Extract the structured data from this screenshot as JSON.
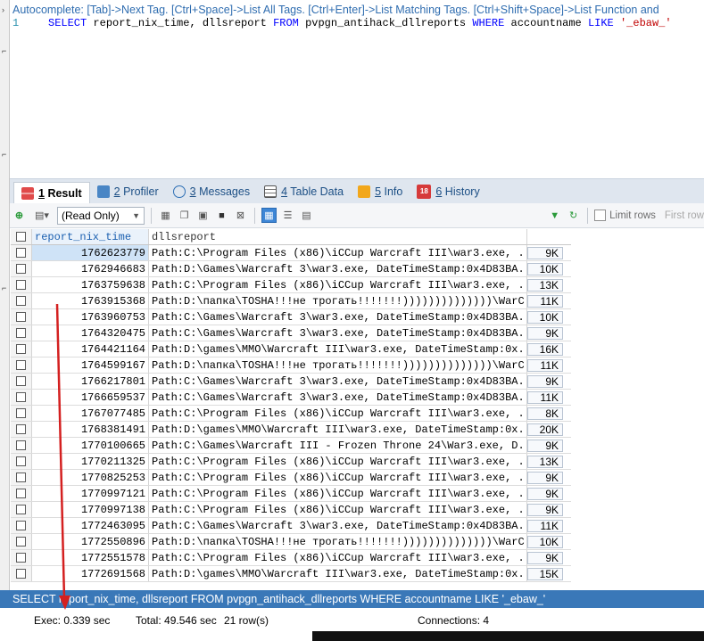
{
  "editor": {
    "autocomplete_hint": "Autocomplete: [Tab]->Next Tag. [Ctrl+Space]->List All Tags. [Ctrl+Enter]->List Matching Tags. [Ctrl+Shift+Space]->List Function and ",
    "line_number": "1",
    "sql": {
      "select": "SELECT",
      "cols": "report_nix_time, dllsreport",
      "from": "FROM",
      "table": "pvpgn_antihack_dllreports",
      "where": "WHERE",
      "col": "accountname",
      "like": "LIKE",
      "value": "'_ebaw_'"
    }
  },
  "tabs": [
    {
      "num": "1",
      "label": "Result",
      "icon": "result-grid-icon"
    },
    {
      "num": "2",
      "label": "Profiler",
      "icon": "profiler-icon"
    },
    {
      "num": "3",
      "label": "Messages",
      "icon": "info-circle-icon"
    },
    {
      "num": "4",
      "label": "Table Data",
      "icon": "table-icon"
    },
    {
      "num": "5",
      "label": "Info",
      "icon": "info-icon"
    },
    {
      "num": "6",
      "label": "History",
      "icon": "calendar-icon",
      "badge": "18"
    }
  ],
  "toolbar": {
    "mode_select": "(Read Only)",
    "limit_rows_label": "Limit rows",
    "first_row_label": "First row"
  },
  "grid": {
    "columns": [
      "report_nix_time",
      "dllsreport"
    ],
    "rows": [
      {
        "time": "1762623779",
        "dll": "Path:C:\\Program Files (x86)\\iCCup Warcraft III\\war3.exe, ...",
        "size": "9K"
      },
      {
        "time": "1762946683",
        "dll": "Path:D:\\Games\\Warcraft 3\\war3.exe, DateTimeStamp:0x4D83BA...",
        "size": "10K"
      },
      {
        "time": "1763759638",
        "dll": "Path:C:\\Program Files (x86)\\iCCup Warcraft III\\war3.exe, ...",
        "size": "13K"
      },
      {
        "time": "1763915368",
        "dll": "Path:D:\\папка\\TOSHA!!!не трогать!!!!!!!))))))))))))))\\WarC...",
        "size": "11K"
      },
      {
        "time": "1763960753",
        "dll": "Path:C:\\Games\\Warcraft 3\\war3.exe, DateTimeStamp:0x4D83BA...",
        "size": "10K"
      },
      {
        "time": "1764320475",
        "dll": "Path:C:\\Games\\Warcraft 3\\war3.exe, DateTimeStamp:0x4D83BA...",
        "size": "9K"
      },
      {
        "time": "1764421164",
        "dll": "Path:D:\\games\\MMO\\Warcraft III\\war3.exe, DateTimeStamp:0x...",
        "size": "16K"
      },
      {
        "time": "1764599167",
        "dll": "Path:D:\\папка\\TOSHA!!!не трогать!!!!!!!))))))))))))))\\WarC...",
        "size": "11K"
      },
      {
        "time": "1766217801",
        "dll": "Path:C:\\Games\\Warcraft 3\\war3.exe, DateTimeStamp:0x4D83BA...",
        "size": "9K"
      },
      {
        "time": "1766659537",
        "dll": "Path:C:\\Games\\Warcraft 3\\war3.exe, DateTimeStamp:0x4D83BA...",
        "size": "11K"
      },
      {
        "time": "1767077485",
        "dll": "Path:C:\\Program Files (x86)\\iCCup Warcraft III\\war3.exe, ...",
        "size": "8K"
      },
      {
        "time": "1768381491",
        "dll": "Path:D:\\games\\MMO\\Warcraft III\\war3.exe, DateTimeStamp:0x...",
        "size": "20K"
      },
      {
        "time": "1770100665",
        "dll": "Path:C:\\Games\\Warcraft III - Frozen Throne 24\\War3.exe, D...",
        "size": "9K"
      },
      {
        "time": "1770211325",
        "dll": "Path:C:\\Program Files (x86)\\iCCup Warcraft III\\war3.exe, ...",
        "size": "13K"
      },
      {
        "time": "1770825253",
        "dll": "Path:C:\\Program Files (x86)\\iCCup Warcraft III\\war3.exe, ...",
        "size": "9K"
      },
      {
        "time": "1770997121",
        "dll": "Path:C:\\Program Files (x86)\\iCCup Warcraft III\\war3.exe, ...",
        "size": "9K"
      },
      {
        "time": "1770997138",
        "dll": "Path:C:\\Program Files (x86)\\iCCup Warcraft III\\war3.exe, ...",
        "size": "9K"
      },
      {
        "time": "1772463095",
        "dll": "Path:C:\\Games\\Warcraft 3\\war3.exe, DateTimeStamp:0x4D83BA...",
        "size": "11K"
      },
      {
        "time": "1772550896",
        "dll": "Path:D:\\папка\\TOSHA!!!не трогать!!!!!!!))))))))))))))\\WarC...",
        "size": "10K"
      },
      {
        "time": "1772551578",
        "dll": "Path:C:\\Program Files (x86)\\iCCup Warcraft III\\war3.exe, ...",
        "size": "9K"
      },
      {
        "time": "1772691568",
        "dll": "Path:D:\\games\\MMO\\Warcraft III\\war3.exe, DateTimeStamp:0x...",
        "size": "15K"
      }
    ]
  },
  "sqlbar": {
    "text": "SELECT report_nix_time, dllsreport FROM pvpgn_antihack_dllreports WHERE accountname LIKE '_ebaw_'"
  },
  "status": {
    "exec": "Exec: 0.339 sec",
    "total": "Total: 49.546 sec",
    "rows": "21 row(s)",
    "connections": "Connections: 4"
  },
  "colors": {
    "accent_blue": "#3a78b8",
    "annotation_red": "#d42020"
  }
}
